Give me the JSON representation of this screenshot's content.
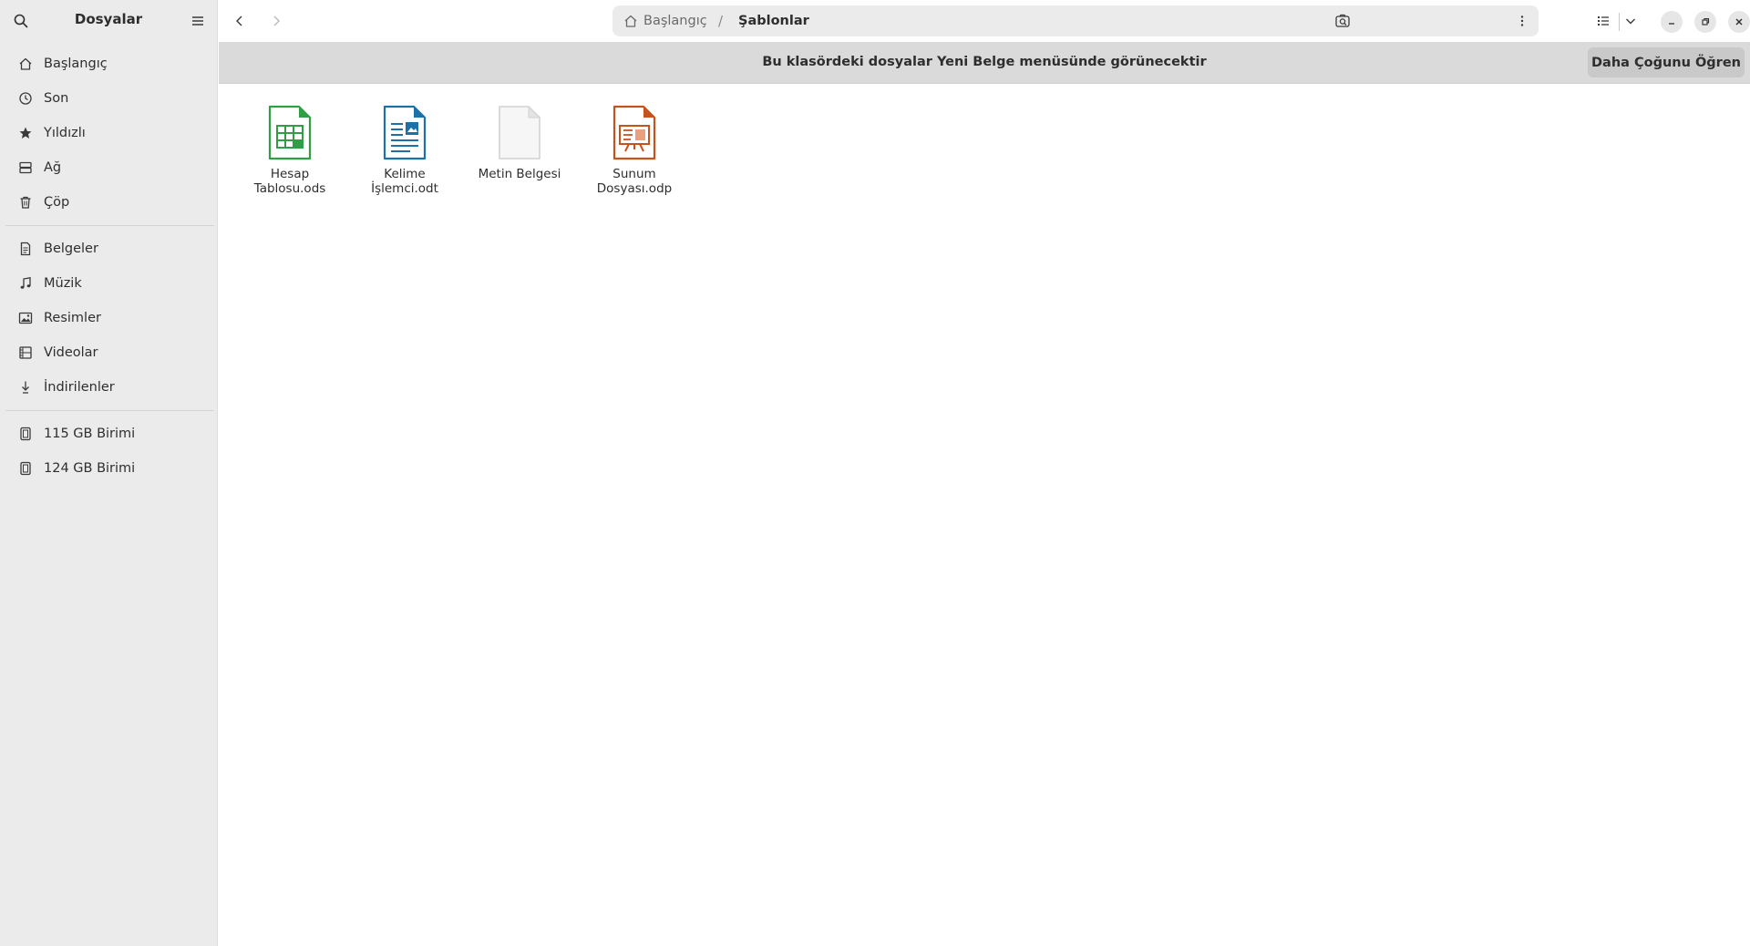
{
  "sidebar": {
    "title": "Dosyalar",
    "search_icon": "search-icon",
    "menu_icon": "hamburger-menu-icon",
    "places": [
      {
        "label": "Başlangıç",
        "icon": "home-icon"
      },
      {
        "label": "Son",
        "icon": "clock-icon"
      },
      {
        "label": "Yıldızlı",
        "icon": "star-icon"
      },
      {
        "label": "Ağ",
        "icon": "network-icon"
      },
      {
        "label": "Çöp",
        "icon": "trash-icon"
      }
    ],
    "folders": [
      {
        "label": "Belgeler",
        "icon": "document-icon"
      },
      {
        "label": "Müzik",
        "icon": "music-icon"
      },
      {
        "label": "Resimler",
        "icon": "image-icon"
      },
      {
        "label": "Videolar",
        "icon": "film-icon"
      },
      {
        "label": "İndirilenler",
        "icon": "download-icon"
      }
    ],
    "volumes": [
      {
        "label": "115 GB Birimi",
        "icon": "drive-icon"
      },
      {
        "label": "124 GB Birimi",
        "icon": "drive-icon"
      }
    ]
  },
  "header": {
    "path": {
      "home": "Başlangıç",
      "separator": "/",
      "current": "Şablonlar"
    }
  },
  "banner": {
    "text": "Bu klasördeki dosyalar Yeni Belge menüsünde görünecektir",
    "button": "Daha Çoğunu Öğren"
  },
  "files": [
    {
      "name": "Hesap Tablosu.ods",
      "icon": "spreadsheet-icon",
      "color": "#2f9e44"
    },
    {
      "name": "Kelime İşlemci.odt",
      "icon": "word-processor-icon",
      "color": "#1c71a8"
    },
    {
      "name": "Metin Belgesi",
      "icon": "text-document-icon",
      "color": "#d6d6d6"
    },
    {
      "name": "Sunum Dosyası.odp",
      "icon": "presentation-icon",
      "color": "#c6531e"
    }
  ]
}
